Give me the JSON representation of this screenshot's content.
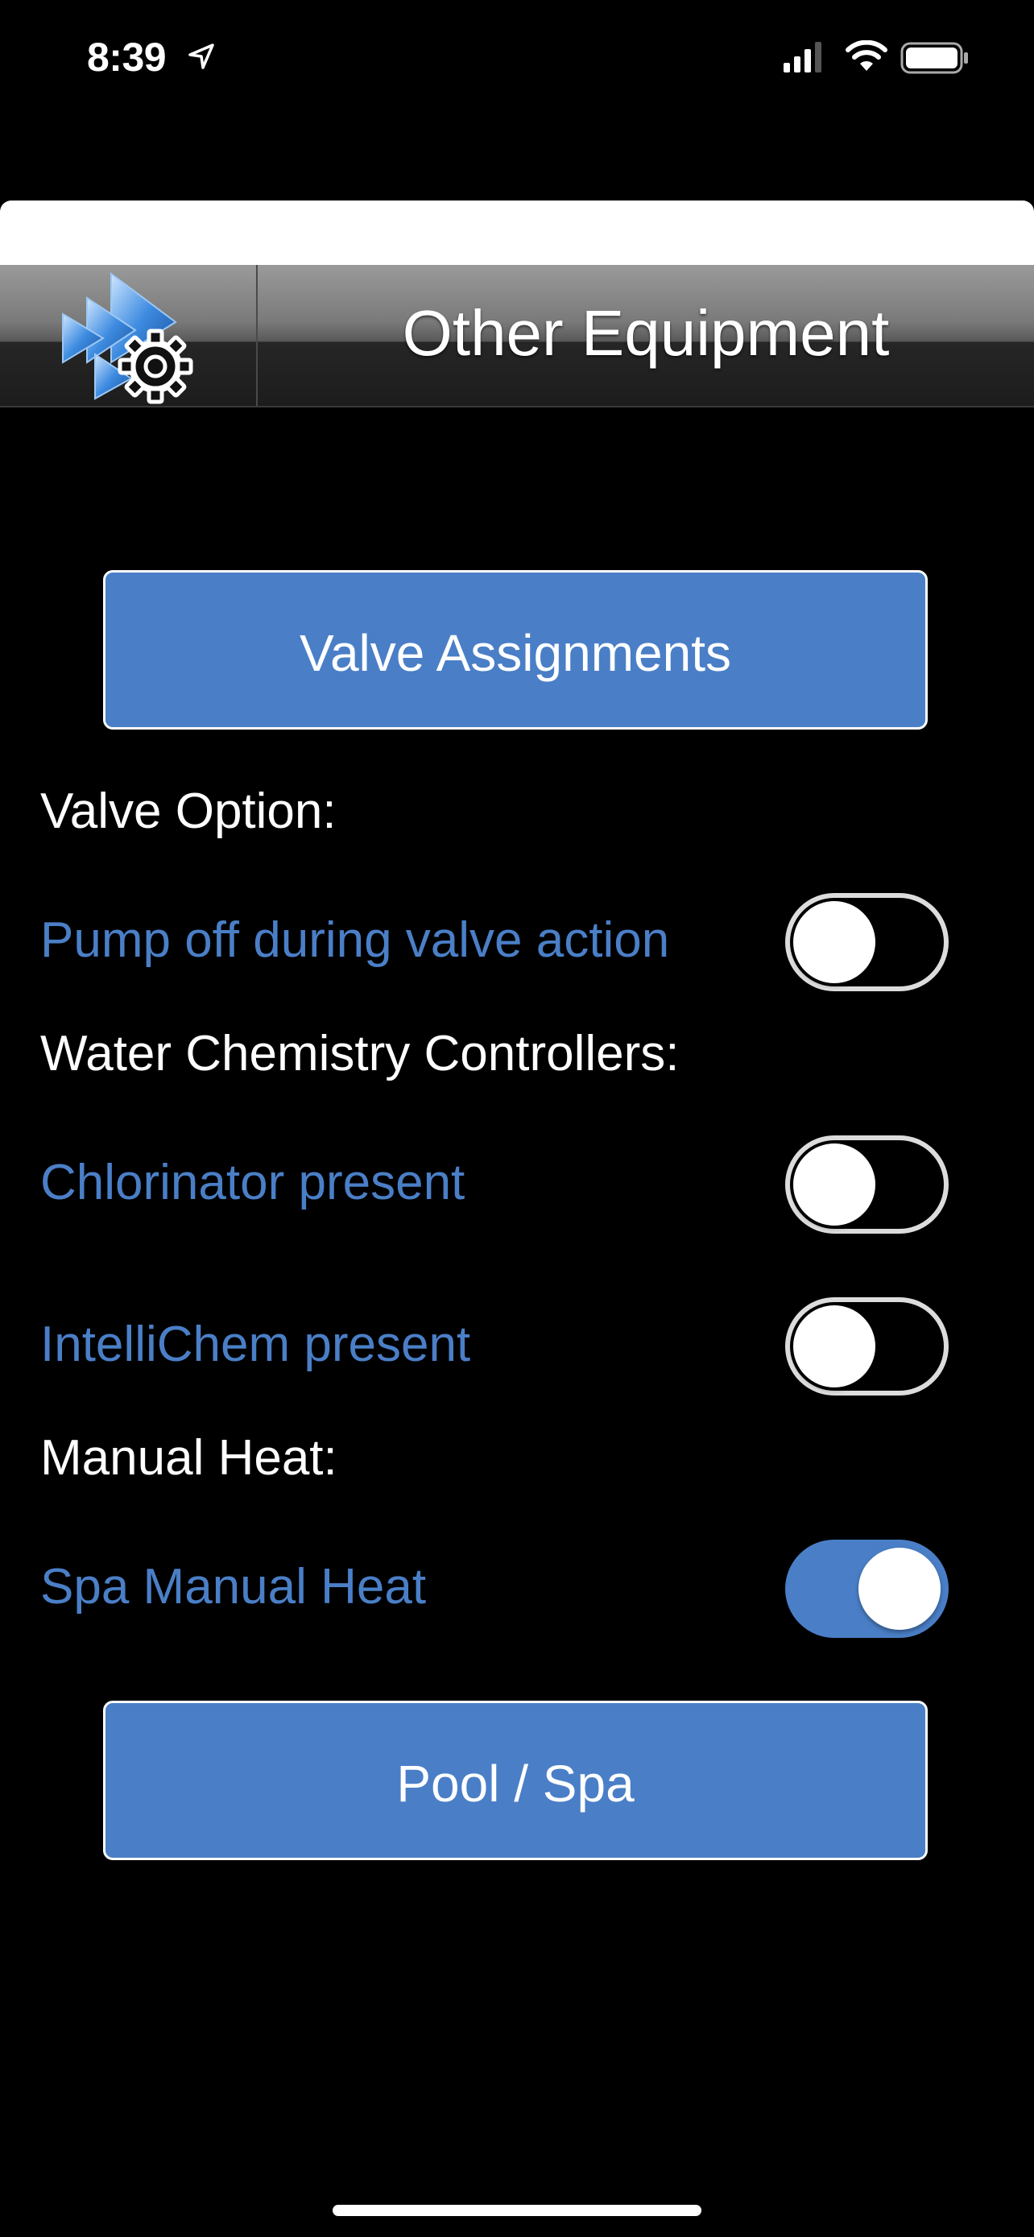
{
  "status_bar": {
    "time": "8:39",
    "location_icon": "location-arrow-icon",
    "signal_icon": "cellular-signal-icon",
    "wifi_icon": "wifi-icon",
    "battery_icon": "battery-icon"
  },
  "header": {
    "title": "Other Equipment",
    "logo_icon": "settings-gear-logo-icon"
  },
  "buttons": {
    "valve_assignments": "Valve Assignments",
    "pool_spa": "Pool / Spa"
  },
  "sections": {
    "valve_option": "Valve Option:",
    "water_chemistry": "Water Chemistry Controllers:",
    "manual_heat": "Manual Heat:"
  },
  "options": {
    "pump_off": {
      "label": "Pump off during valve action",
      "on": false
    },
    "chlorinator": {
      "label": "Chlorinator present",
      "on": false
    },
    "intellichem": {
      "label": "IntelliChem present",
      "on": false
    },
    "spa_manual_heat": {
      "label": "Spa Manual Heat",
      "on": true
    }
  },
  "colors": {
    "accent_blue": "#4a7fc7",
    "background": "#000000",
    "toggle_off_border": "#dcdcdc"
  }
}
